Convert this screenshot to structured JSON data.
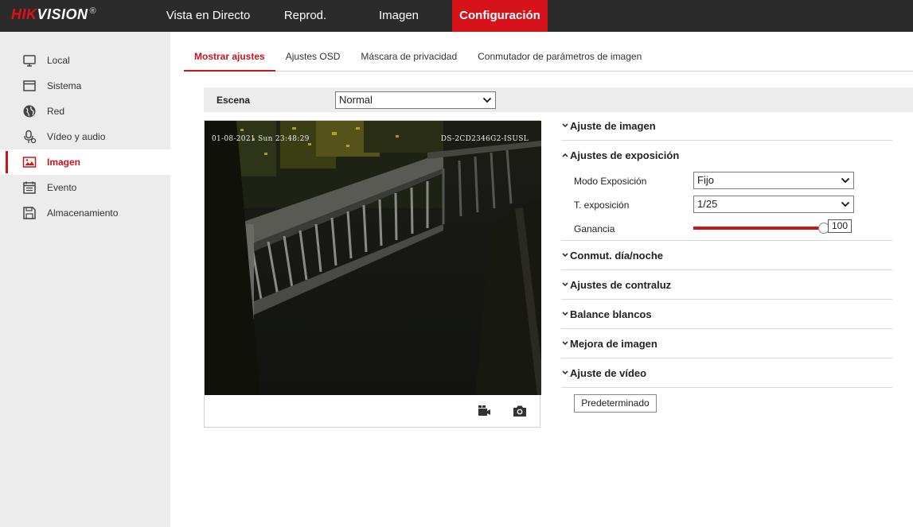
{
  "brand": {
    "name_red": "HIK",
    "name_white": "VISION",
    "registered": "®"
  },
  "topnav": [
    {
      "label": "Vista en Directo",
      "active": false
    },
    {
      "label": "Reprod.",
      "active": false
    },
    {
      "label": "Imagen",
      "active": false
    },
    {
      "label": "Configuración",
      "active": true
    }
  ],
  "sidebar": {
    "items": [
      {
        "label": "Local",
        "icon": "monitor-icon",
        "active": false
      },
      {
        "label": "Sistema",
        "icon": "window-icon",
        "active": false
      },
      {
        "label": "Red",
        "icon": "globe-icon",
        "active": false
      },
      {
        "label": "Vídeo y audio",
        "icon": "microphone-icon",
        "active": false
      },
      {
        "label": "Imagen",
        "icon": "image-icon",
        "active": true
      },
      {
        "label": "Evento",
        "icon": "calendar-icon",
        "active": false
      },
      {
        "label": "Almacenamiento",
        "icon": "floppy-icon",
        "active": false
      }
    ]
  },
  "tabs": [
    {
      "label": "Mostrar ajustes",
      "active": true
    },
    {
      "label": "Ajustes OSD",
      "active": false
    },
    {
      "label": "Máscara de privacidad",
      "active": false
    },
    {
      "label": "Conmutador de parámetros de imagen",
      "active": false
    }
  ],
  "scene": {
    "label": "Escena",
    "value": "Normal"
  },
  "video": {
    "osd_time": "01-08-2021 Sun 23:48:29",
    "osd_model": "DS-2CD2346G2-ISUSL"
  },
  "panel": {
    "sections": [
      {
        "title": "Ajuste de imagen",
        "expanded": false
      },
      {
        "title": "Ajustes de exposición",
        "expanded": true
      },
      {
        "title": "Conmut. día/noche",
        "expanded": false
      },
      {
        "title": "Ajustes de contraluz",
        "expanded": false
      },
      {
        "title": "Balance blancos",
        "expanded": false
      },
      {
        "title": "Mejora de imagen",
        "expanded": false
      },
      {
        "title": "Ajuste de vídeo",
        "expanded": false
      }
    ],
    "exposure": {
      "mode_label": "Modo Exposición",
      "mode_value": "Fijo",
      "time_label": "T. exposición",
      "time_value": "1/25",
      "gain_label": "Ganancia",
      "gain_value": "100",
      "gain_fraction": 1.0
    }
  },
  "default_button": "Predeterminado",
  "colors": {
    "accent": "#c8161d",
    "topbar": "#2b2b2b",
    "sidebar": "#ececec"
  }
}
